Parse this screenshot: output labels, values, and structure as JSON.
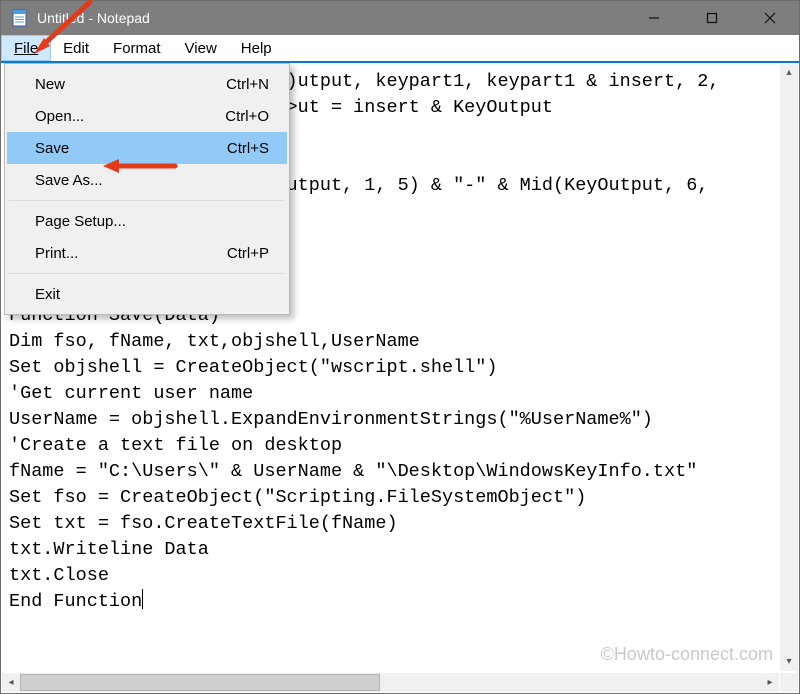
{
  "window": {
    "title": "Untitled - Notepad"
  },
  "menubar": {
    "file": "File",
    "edit": "Edit",
    "format": "Format",
    "view": "View",
    "help": "Help"
  },
  "file_menu": {
    "new": {
      "label": "New",
      "shortcut": "Ctrl+N"
    },
    "open": {
      "label": "Open...",
      "shortcut": "Ctrl+O"
    },
    "save": {
      "label": "Save",
      "shortcut": "Ctrl+S"
    },
    "save_as": {
      "label": "Save As...",
      "shortcut": ""
    },
    "page_setup": {
      "label": "Page Setup...",
      "shortcut": ""
    },
    "print": {
      "label": "Print...",
      "shortcut": "Ctrl+P"
    },
    "exit": {
      "label": "Exit",
      "shortcut": ""
    }
  },
  "editor": {
    "line1": "                         )utput, keypart1, keypart1 & insert, 2,",
    "line2": "                         >ut = insert & KeyOutput",
    "line3": "",
    "line4": "",
    "line5": "                         utput, 1, 5) & \"-\" & Mid(KeyOutput, 6,",
    "line6": "",
    "line7": "",
    "line8": "",
    "line9": "",
    "line10": "Function Save(Data)",
    "line11": "Dim fso, fName, txt,objshell,UserName",
    "line12": "Set objshell = CreateObject(\"wscript.shell\")",
    "line13": "'Get current user name",
    "line14": "UserName = objshell.ExpandEnvironmentStrings(\"%UserName%\")",
    "line15": "'Create a text file on desktop",
    "line16": "fName = \"C:\\Users\\\" & UserName & \"\\Desktop\\WindowsKeyInfo.txt\"",
    "line17": "Set fso = CreateObject(\"Scripting.FileSystemObject\")",
    "line18": "Set txt = fso.CreateTextFile(fName)",
    "line19": "txt.Writeline Data",
    "line20": "txt.Close",
    "line21": "End Function"
  },
  "watermark": "©Howto-connect.com"
}
